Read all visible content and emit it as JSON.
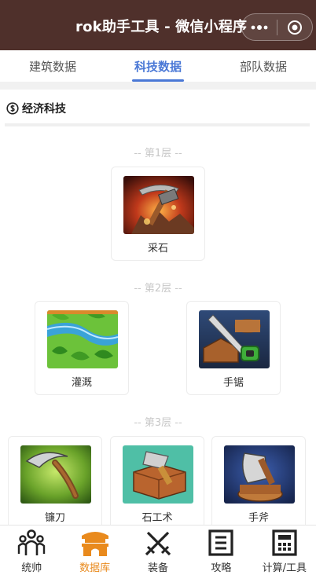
{
  "header": {
    "title": "rok助手工具 - 微信小程序",
    "more_icon": "more-dots-icon",
    "close_icon": "target-circle-icon"
  },
  "tabs": [
    {
      "label": "建筑数据",
      "active": false
    },
    {
      "label": "科技数据",
      "active": true
    },
    {
      "label": "部队数据",
      "active": false
    }
  ],
  "section": {
    "icon": "coin-circle-icon",
    "title": "经济科技"
  },
  "tiers": [
    {
      "label": "-- 第1层 --",
      "items": [
        {
          "name": "采石",
          "icon": "quarrying-pickaxe-icon"
        }
      ]
    },
    {
      "label": "-- 第2层 --",
      "items": [
        {
          "name": "灌溉",
          "icon": "irrigation-icon"
        },
        {
          "name": "手锯",
          "icon": "handsaw-icon"
        }
      ]
    },
    {
      "label": "-- 第3层 --",
      "items": [
        {
          "name": "镰刀",
          "icon": "sickle-icon"
        },
        {
          "name": "石工术",
          "icon": "masonry-icon"
        },
        {
          "name": "手斧",
          "icon": "handaxe-icon"
        }
      ]
    }
  ],
  "bottom_nav": [
    {
      "label": "统帅",
      "icon": "commanders-icon",
      "active": false
    },
    {
      "label": "数据库",
      "icon": "database-gate-icon",
      "active": true
    },
    {
      "label": "装备",
      "icon": "crossed-swords-icon",
      "active": false
    },
    {
      "label": "攻略",
      "icon": "guide-document-icon",
      "active": false
    },
    {
      "label": "计算/工具",
      "icon": "calculator-icon",
      "active": false
    }
  ],
  "colors": {
    "titlebar": "#4f302b",
    "accent_tab": "#4a78d6",
    "accent_nav": "#e98a1d"
  }
}
